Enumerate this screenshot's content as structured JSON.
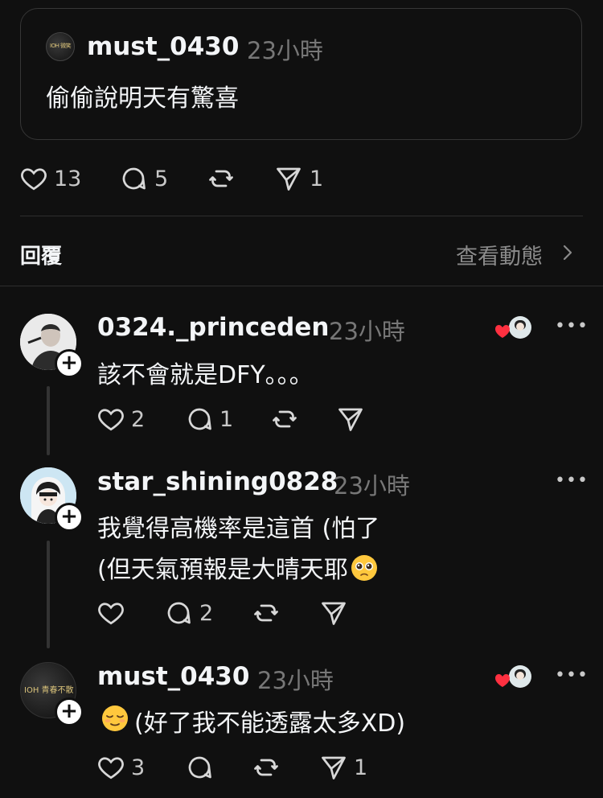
{
  "quote": {
    "username": "must_0430",
    "time": "23小時",
    "text": "偷偷說明天有驚喜",
    "avatar_text": "IOH 微笑"
  },
  "stats": {
    "likes": "13",
    "replies": "5",
    "shares": "1"
  },
  "replies_header": {
    "title": "回覆",
    "activity_link": "查看動態"
  },
  "replies": [
    {
      "username": "0324._princeden",
      "time": "23小時",
      "text": "該不會就是DFY。。。",
      "likes": "2",
      "replies": "1"
    },
    {
      "username": "star_shining0828",
      "time": "23小時",
      "line1": "我覺得高機率是這首 (怕了",
      "line2": "(但天氣預報是大晴天耶",
      "replies": "2"
    },
    {
      "username": "must_0430",
      "time": "23小時",
      "text": "(好了我不能透露太多XD)",
      "likes": "3",
      "shares": "1",
      "avatar_text": "IOH 青春不散"
    }
  ],
  "colors": {
    "background": "#101010",
    "text": "#f3f5f7",
    "muted": "#777777",
    "heart": "#ff3040"
  }
}
